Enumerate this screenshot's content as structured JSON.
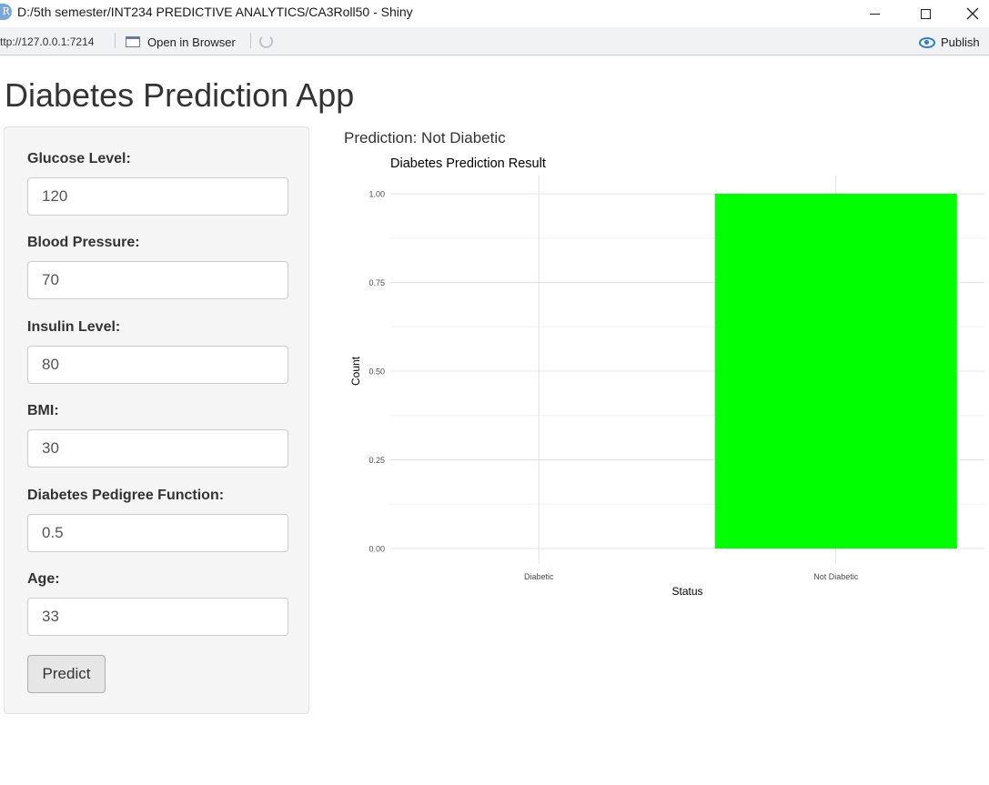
{
  "window": {
    "icon_letter": "R",
    "title": "D:/5th semester/INT234 PREDICTIVE ANALYTICS/CA3Roll50 - Shiny"
  },
  "toolbar": {
    "url": "ttp://127.0.0.1:7214",
    "open_in_browser": "Open in Browser",
    "publish": "Publish"
  },
  "app": {
    "title": "Diabetes Prediction App",
    "prediction": "Prediction: Not Diabetic"
  },
  "form": {
    "fields": [
      {
        "label": "Glucose Level:",
        "value": "120"
      },
      {
        "label": "Blood Pressure:",
        "value": "70"
      },
      {
        "label": "Insulin Level:",
        "value": "80"
      },
      {
        "label": "BMI:",
        "value": "30"
      },
      {
        "label": "Diabetes Pedigree Function:",
        "value": "0.5"
      },
      {
        "label": "Age:",
        "value": "33"
      }
    ],
    "predict_label": "Predict"
  },
  "chart_data": {
    "type": "bar",
    "title": "Diabetes Prediction Result",
    "xlabel": "Status",
    "ylabel": "Count",
    "categories": [
      "Diabetic",
      "Not Diabetic"
    ],
    "values": [
      0,
      1
    ],
    "ylim": [
      0,
      1
    ],
    "yticks": [
      "0.00",
      "0.25",
      "0.50",
      "0.75",
      "1.00"
    ],
    "bar_color": "#00ff00",
    "grid": true,
    "legend": "none"
  }
}
